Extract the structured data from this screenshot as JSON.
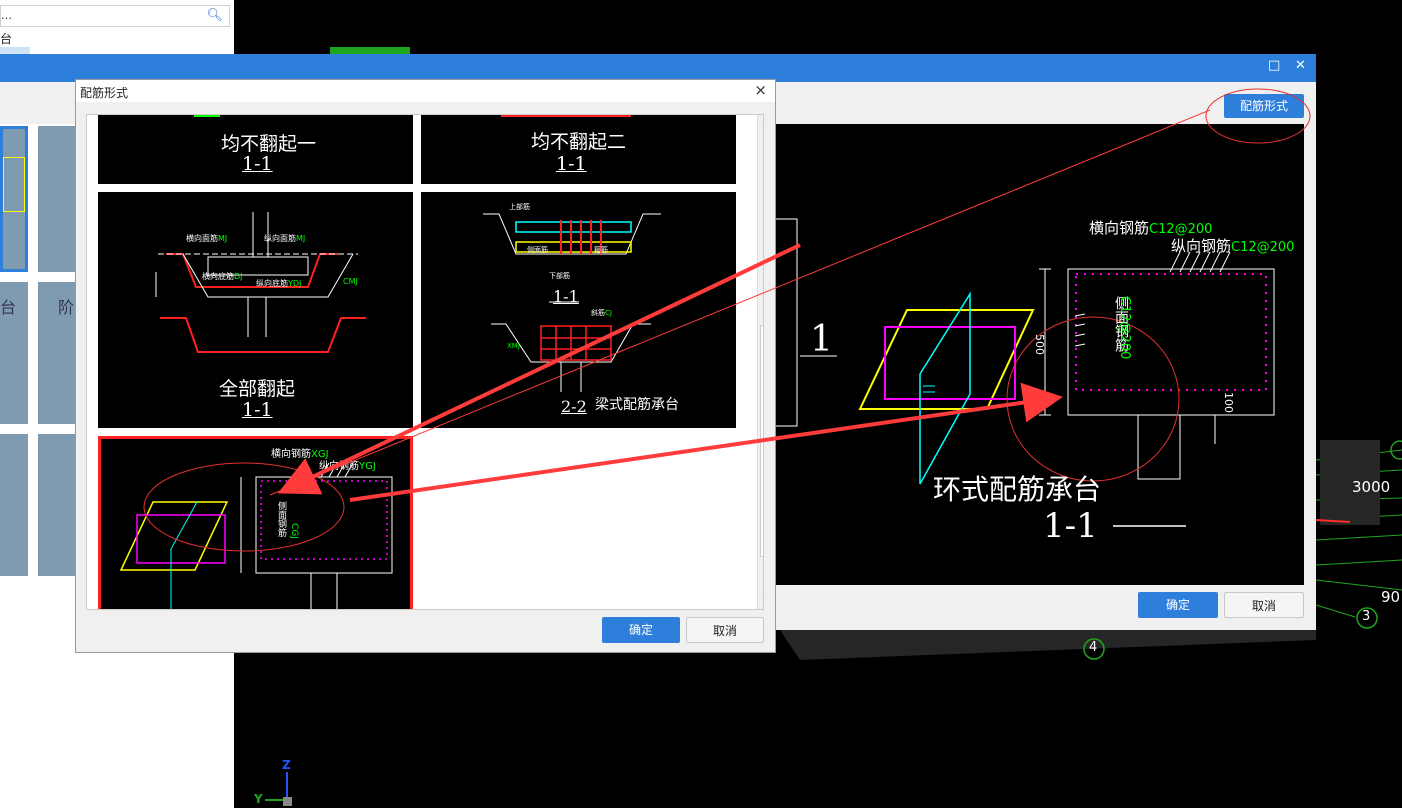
{
  "left_panel": {
    "search_text": "…",
    "tree_items": [
      "台",
      "阶"
    ]
  },
  "big_dialog": {
    "toolbar_button": "配筋形式",
    "ok": "确定",
    "cancel": "取消",
    "preview": {
      "title": "环式配筋承台",
      "section": "1-1",
      "label_h": "横向钢筋",
      "label_h_spec": "C12@200",
      "label_v": "纵向钢筋",
      "label_v_spec": "C12@200",
      "label_side": "侧面钢筋",
      "label_side_spec": "C12@200",
      "dim_500": "500",
      "dim_100": "100",
      "big_1": "1"
    }
  },
  "small_dialog": {
    "title": "配筋形式",
    "ok": "确定",
    "cancel": "取消",
    "options": [
      {
        "title": "均不翻起一",
        "section": "1-1"
      },
      {
        "title": "均不翻起二",
        "section": "1-1"
      },
      {
        "title": "全部翻起",
        "section": "1-1",
        "labels": [
          "横向面筋",
          "MJ",
          "纵向面筋",
          "MJ",
          "横向底筋",
          "DJ",
          "纵向底筋",
          "YDJ",
          "CMJ"
        ]
      },
      {
        "title": "梁式配筋承台",
        "section": "1-1",
        "section2": "2-2",
        "labels": [
          "上部筋",
          "侧面筋",
          "下部筋",
          "箍筋",
          "斜筋",
          "CJ",
          "XMJ"
        ]
      },
      {
        "title": "",
        "section": "",
        "labels": [
          "横向钢筋",
          "XGJ",
          "纵向钢筋",
          "YGJ",
          "侧面钢筋",
          "CGJ"
        ]
      }
    ]
  },
  "background": {
    "dim_3000": "3000",
    "dim_90": "90",
    "axis_3": "3",
    "axis_4": "4",
    "axis_z": "Z",
    "axis_y": "Y"
  },
  "colors": {
    "accent": "#2d7fdb",
    "arrow": "#ff3b3b",
    "cad_yellow": "#ffff00",
    "cad_magenta": "#ff00ff",
    "cad_cyan": "#00ffff",
    "cad_green": "#00ff00"
  }
}
